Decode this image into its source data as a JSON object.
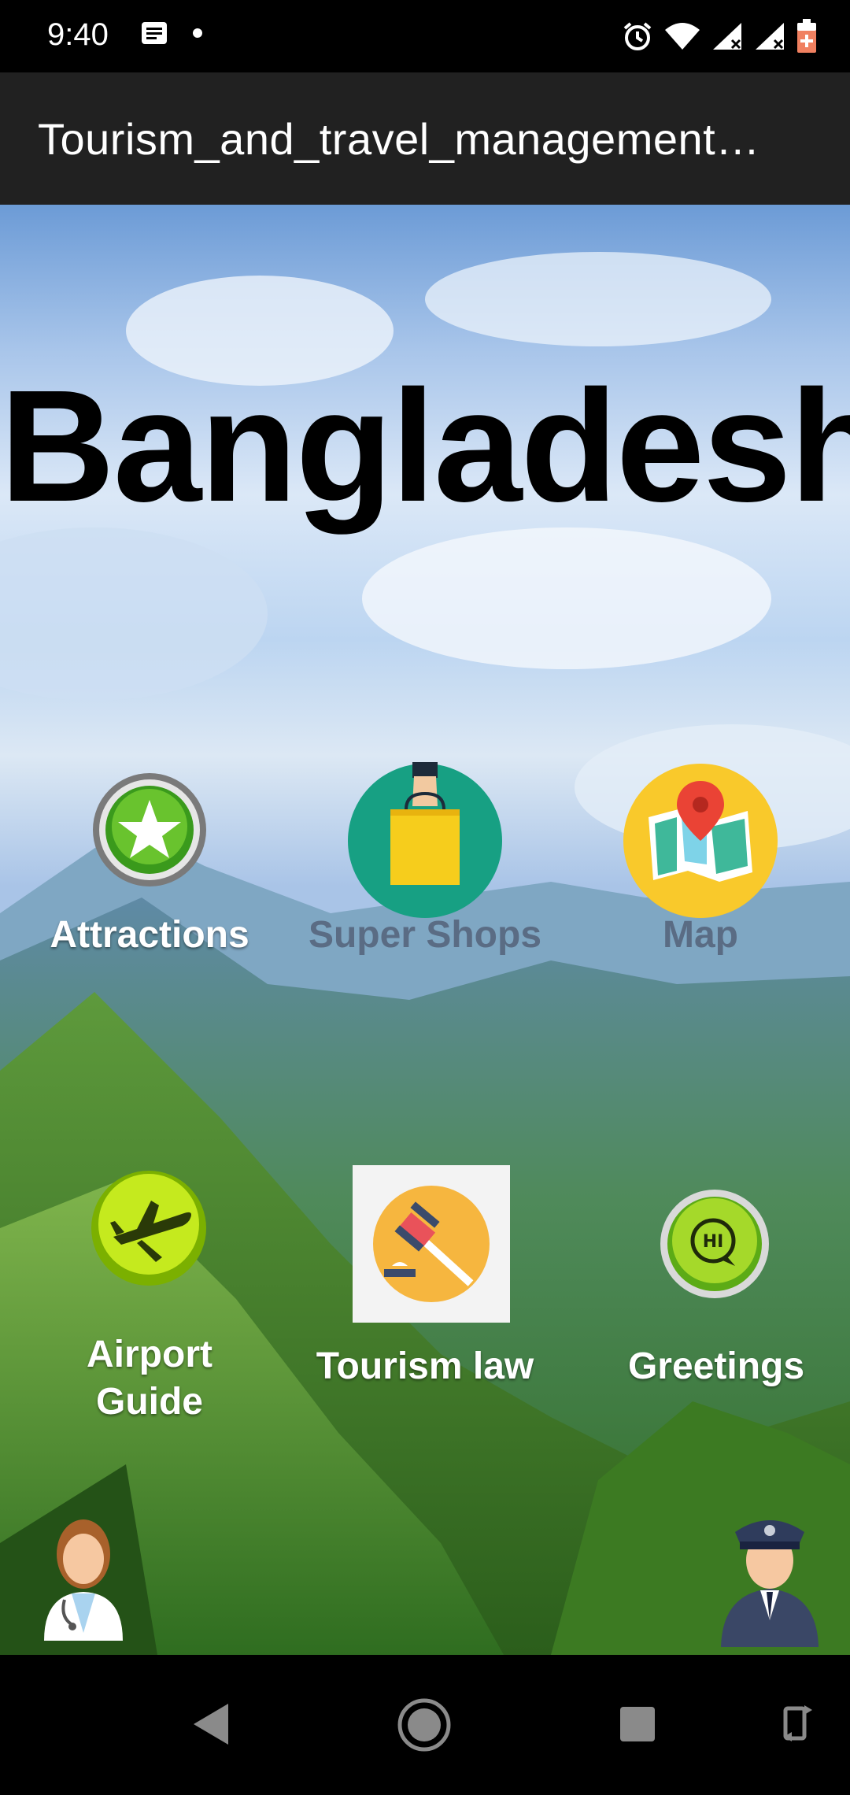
{
  "status": {
    "time": "9:40",
    "icons": [
      "notification-icon",
      "dot-icon",
      "alarm-icon",
      "wifi-icon",
      "signal-icon",
      "signal-icon",
      "battery-charging-icon"
    ]
  },
  "app_bar": {
    "title": "Tourism_and_travel_management…"
  },
  "hero": {
    "title": "Bangladesh"
  },
  "menu": {
    "attractions": "Attractions",
    "super_shops": "Super Shops",
    "map": "Map",
    "airport_guide_line1": "Airport",
    "airport_guide_line2": "Guide",
    "tourism_law": "Tourism law",
    "greetings": "Greetings"
  },
  "colors": {
    "app_bar": "#212121",
    "status_bar": "#000000",
    "label_text": "#ffffff",
    "label_dim": "#5a6c84"
  },
  "nav": {
    "icons": [
      "back-icon",
      "home-icon",
      "recents-icon",
      "rotate-icon"
    ]
  }
}
